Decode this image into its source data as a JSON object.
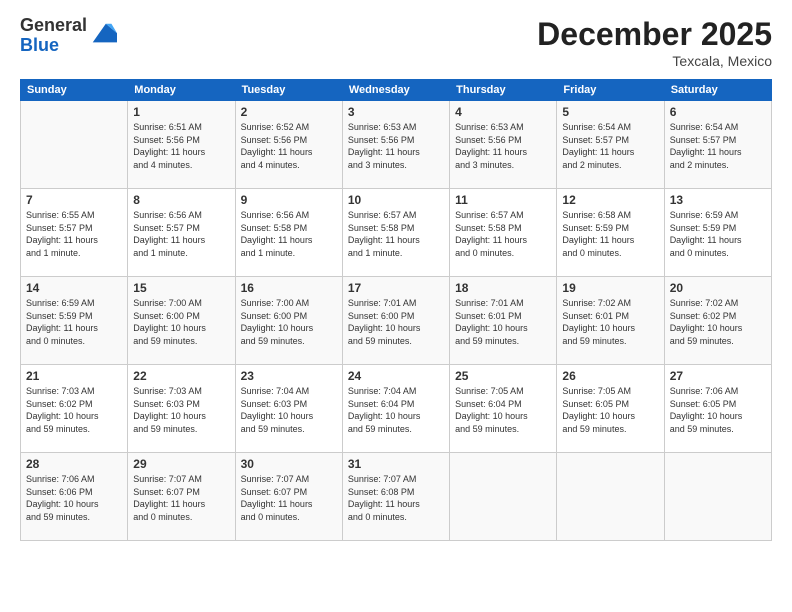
{
  "header": {
    "logo_general": "General",
    "logo_blue": "Blue",
    "month": "December 2025",
    "location": "Texcala, Mexico"
  },
  "days_of_week": [
    "Sunday",
    "Monday",
    "Tuesday",
    "Wednesday",
    "Thursday",
    "Friday",
    "Saturday"
  ],
  "weeks": [
    [
      {
        "day": "",
        "info": ""
      },
      {
        "day": "1",
        "info": "Sunrise: 6:51 AM\nSunset: 5:56 PM\nDaylight: 11 hours\nand 4 minutes."
      },
      {
        "day": "2",
        "info": "Sunrise: 6:52 AM\nSunset: 5:56 PM\nDaylight: 11 hours\nand 4 minutes."
      },
      {
        "day": "3",
        "info": "Sunrise: 6:53 AM\nSunset: 5:56 PM\nDaylight: 11 hours\nand 3 minutes."
      },
      {
        "day": "4",
        "info": "Sunrise: 6:53 AM\nSunset: 5:56 PM\nDaylight: 11 hours\nand 3 minutes."
      },
      {
        "day": "5",
        "info": "Sunrise: 6:54 AM\nSunset: 5:57 PM\nDaylight: 11 hours\nand 2 minutes."
      },
      {
        "day": "6",
        "info": "Sunrise: 6:54 AM\nSunset: 5:57 PM\nDaylight: 11 hours\nand 2 minutes."
      }
    ],
    [
      {
        "day": "7",
        "info": "Sunrise: 6:55 AM\nSunset: 5:57 PM\nDaylight: 11 hours\nand 1 minute."
      },
      {
        "day": "8",
        "info": "Sunrise: 6:56 AM\nSunset: 5:57 PM\nDaylight: 11 hours\nand 1 minute."
      },
      {
        "day": "9",
        "info": "Sunrise: 6:56 AM\nSunset: 5:58 PM\nDaylight: 11 hours\nand 1 minute."
      },
      {
        "day": "10",
        "info": "Sunrise: 6:57 AM\nSunset: 5:58 PM\nDaylight: 11 hours\nand 1 minute."
      },
      {
        "day": "11",
        "info": "Sunrise: 6:57 AM\nSunset: 5:58 PM\nDaylight: 11 hours\nand 0 minutes."
      },
      {
        "day": "12",
        "info": "Sunrise: 6:58 AM\nSunset: 5:59 PM\nDaylight: 11 hours\nand 0 minutes."
      },
      {
        "day": "13",
        "info": "Sunrise: 6:59 AM\nSunset: 5:59 PM\nDaylight: 11 hours\nand 0 minutes."
      }
    ],
    [
      {
        "day": "14",
        "info": "Sunrise: 6:59 AM\nSunset: 5:59 PM\nDaylight: 11 hours\nand 0 minutes."
      },
      {
        "day": "15",
        "info": "Sunrise: 7:00 AM\nSunset: 6:00 PM\nDaylight: 10 hours\nand 59 minutes."
      },
      {
        "day": "16",
        "info": "Sunrise: 7:00 AM\nSunset: 6:00 PM\nDaylight: 10 hours\nand 59 minutes."
      },
      {
        "day": "17",
        "info": "Sunrise: 7:01 AM\nSunset: 6:00 PM\nDaylight: 10 hours\nand 59 minutes."
      },
      {
        "day": "18",
        "info": "Sunrise: 7:01 AM\nSunset: 6:01 PM\nDaylight: 10 hours\nand 59 minutes."
      },
      {
        "day": "19",
        "info": "Sunrise: 7:02 AM\nSunset: 6:01 PM\nDaylight: 10 hours\nand 59 minutes."
      },
      {
        "day": "20",
        "info": "Sunrise: 7:02 AM\nSunset: 6:02 PM\nDaylight: 10 hours\nand 59 minutes."
      }
    ],
    [
      {
        "day": "21",
        "info": "Sunrise: 7:03 AM\nSunset: 6:02 PM\nDaylight: 10 hours\nand 59 minutes."
      },
      {
        "day": "22",
        "info": "Sunrise: 7:03 AM\nSunset: 6:03 PM\nDaylight: 10 hours\nand 59 minutes."
      },
      {
        "day": "23",
        "info": "Sunrise: 7:04 AM\nSunset: 6:03 PM\nDaylight: 10 hours\nand 59 minutes."
      },
      {
        "day": "24",
        "info": "Sunrise: 7:04 AM\nSunset: 6:04 PM\nDaylight: 10 hours\nand 59 minutes."
      },
      {
        "day": "25",
        "info": "Sunrise: 7:05 AM\nSunset: 6:04 PM\nDaylight: 10 hours\nand 59 minutes."
      },
      {
        "day": "26",
        "info": "Sunrise: 7:05 AM\nSunset: 6:05 PM\nDaylight: 10 hours\nand 59 minutes."
      },
      {
        "day": "27",
        "info": "Sunrise: 7:06 AM\nSunset: 6:05 PM\nDaylight: 10 hours\nand 59 minutes."
      }
    ],
    [
      {
        "day": "28",
        "info": "Sunrise: 7:06 AM\nSunset: 6:06 PM\nDaylight: 10 hours\nand 59 minutes."
      },
      {
        "day": "29",
        "info": "Sunrise: 7:07 AM\nSunset: 6:07 PM\nDaylight: 11 hours\nand 0 minutes."
      },
      {
        "day": "30",
        "info": "Sunrise: 7:07 AM\nSunset: 6:07 PM\nDaylight: 11 hours\nand 0 minutes."
      },
      {
        "day": "31",
        "info": "Sunrise: 7:07 AM\nSunset: 6:08 PM\nDaylight: 11 hours\nand 0 minutes."
      },
      {
        "day": "",
        "info": ""
      },
      {
        "day": "",
        "info": ""
      },
      {
        "day": "",
        "info": ""
      }
    ]
  ]
}
